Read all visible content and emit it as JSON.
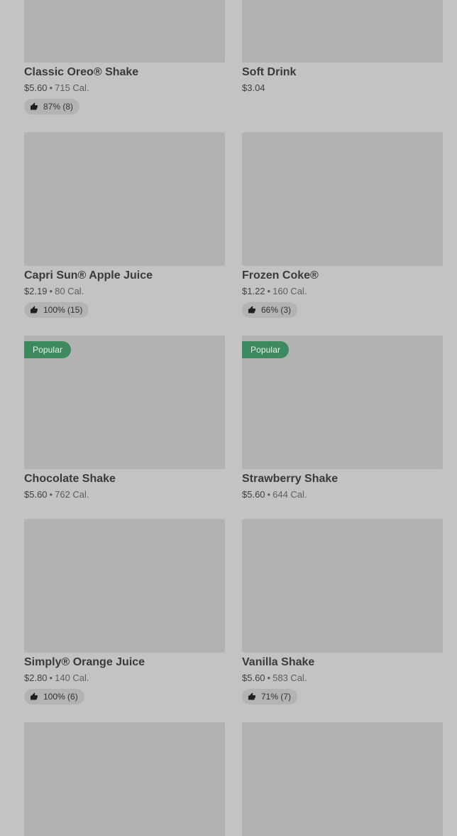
{
  "items": [
    {
      "name": "Classic Oreo® Shake",
      "price": "$5.60",
      "calories": "715 Cal.",
      "rating": "87% (8)",
      "badge": ""
    },
    {
      "name": "Soft Drink",
      "price": "$3.04",
      "calories": "",
      "rating": "",
      "badge": ""
    },
    {
      "name": "Capri Sun® Apple Juice",
      "price": "$2.19",
      "calories": "80 Cal.",
      "rating": "100% (15)",
      "badge": ""
    },
    {
      "name": "Frozen Coke®",
      "price": "$1.22",
      "calories": "160 Cal.",
      "rating": "66% (3)",
      "badge": ""
    },
    {
      "name": "Chocolate Shake",
      "price": "$5.60",
      "calories": "762 Cal.",
      "rating": "",
      "badge": "Popular"
    },
    {
      "name": "Strawberry Shake",
      "price": "$5.60",
      "calories": "644 Cal.",
      "rating": "",
      "badge": "Popular"
    },
    {
      "name": "Simply® Orange Juice",
      "price": "$2.80",
      "calories": "140 Cal.",
      "rating": "100% (6)",
      "badge": ""
    },
    {
      "name": "Vanilla Shake",
      "price": "$5.60",
      "calories": "583 Cal.",
      "rating": "71% (7)",
      "badge": ""
    },
    {
      "name": "",
      "price": "",
      "calories": "",
      "rating": "",
      "badge": ""
    },
    {
      "name": "",
      "price": "",
      "calories": "",
      "rating": "",
      "badge": ""
    }
  ],
  "separator": "•",
  "icons": {
    "rating": "thumbs-up-icon"
  },
  "colors": {
    "badge": "#3d8a5e",
    "background": "#c3c3c3",
    "image_placeholder": "#b2b2b2"
  }
}
